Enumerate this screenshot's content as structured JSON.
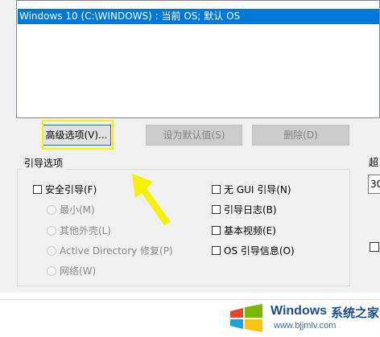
{
  "boot_list": {
    "items": [
      "Windows 10 (C:\\WINDOWS) : 当前 OS; 默认 OS"
    ]
  },
  "buttons": {
    "advanced": "高级选项(V)...",
    "set_default": "设为默认值(S)",
    "delete": "删除(D)"
  },
  "boot_options": {
    "title": "引导选项",
    "safe_boot": "安全引导(F)",
    "minimal": "最小(M)",
    "alternate_shell": "其他外壳(L)",
    "active_directory": "Active Directory 修复(P)",
    "network": "网络(W)",
    "no_gui": "无 GUI 引导(N)",
    "boot_log": "引导日志(B)",
    "base_video": "基本视频(E)",
    "os_boot_info": "OS 引导信息(O)"
  },
  "right_panel": {
    "label": "超",
    "value": "30"
  },
  "watermark": {
    "brand": "Windows",
    "cn": "系统之家",
    "url": "www.bjjmlv.com"
  },
  "colors": {
    "selection": "#0078d7",
    "highlight": "#f5f100",
    "arrow": "#f5f100"
  }
}
